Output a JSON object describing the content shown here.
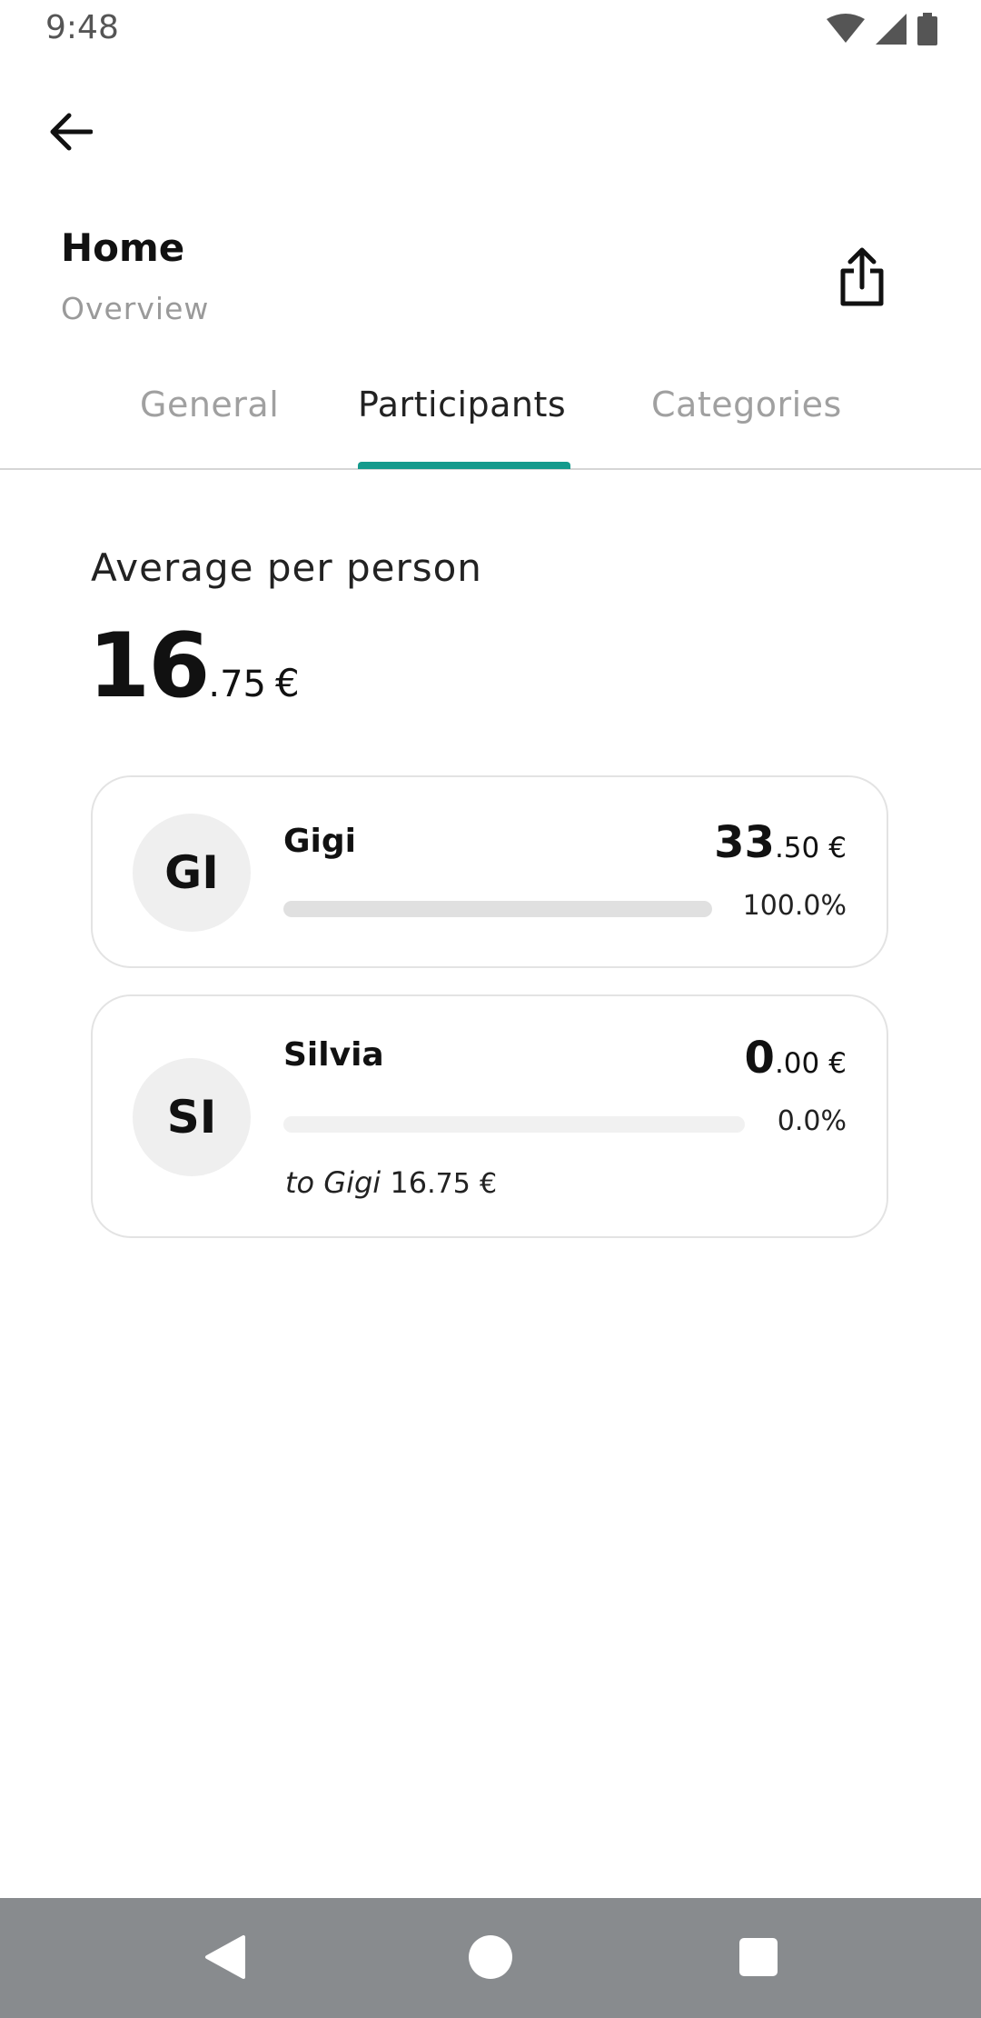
{
  "status_bar": {
    "time": "9:48",
    "icons": [
      "wifi-icon",
      "cellular-signal-icon",
      "battery-icon"
    ]
  },
  "header": {
    "title": "Home",
    "subtitle": "Overview",
    "back_icon": "arrow-left-icon",
    "share_icon": "share-icon"
  },
  "tabs": [
    {
      "label": "General",
      "active": false
    },
    {
      "label": "Participants",
      "active": true
    },
    {
      "label": "Categories",
      "active": false
    }
  ],
  "average": {
    "label": "Average per person",
    "integer": "16",
    "decimal": ".75",
    "currency": "€"
  },
  "participants": [
    {
      "initials": "GI",
      "name": "Gigi",
      "amount_int": "33",
      "amount_dec": ".50",
      "currency": "€",
      "share_percent": "100.0%",
      "share_fraction": 1.0
    },
    {
      "initials": "SI",
      "name": "Silvia",
      "amount_int": "0",
      "amount_dec": ".00",
      "currency": "€",
      "share_percent": "0.0%",
      "share_fraction": 0.0,
      "settlement": {
        "to_text": "to Gigi",
        "amount_int": "16",
        "amount_dec": ".75",
        "currency": "€"
      }
    }
  ],
  "nav_bar": {
    "buttons": [
      "back-triangle-icon",
      "home-circle-icon",
      "recents-square-icon"
    ]
  },
  "colors": {
    "accent": "#159a8c",
    "nav_bar": "#888b8e",
    "muted_text": "#9a9a9a"
  }
}
